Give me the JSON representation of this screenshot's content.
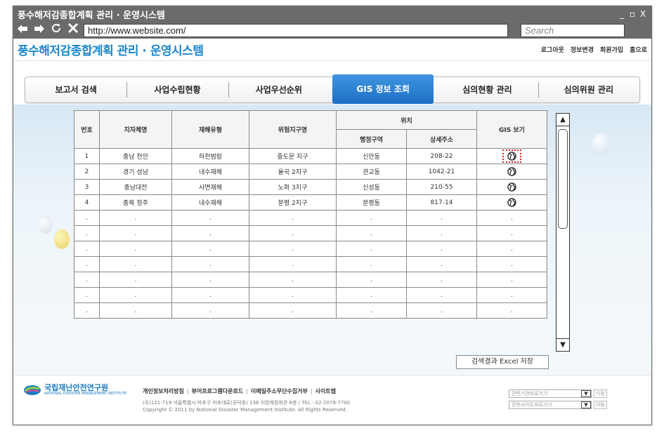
{
  "window": {
    "title": "풍수해저감종합계획 관리 · 운영시스템",
    "controls": [
      "_",
      "▫",
      "X"
    ]
  },
  "browser": {
    "url": "http://www.website.com/",
    "search_placeholder": "Search"
  },
  "header": {
    "brand": "풍수해저감종합계획 관리 · 운영시스템",
    "links": [
      "로그아웃",
      "정보변경",
      "회원가입",
      "홈으로"
    ]
  },
  "tabs": [
    {
      "label": "보고서 검색",
      "active": false
    },
    {
      "label": "사업수립현황",
      "active": false
    },
    {
      "label": "사업우선순위",
      "active": false
    },
    {
      "label": "GIS 정보 조회",
      "active": true
    },
    {
      "label": "심의현황 관리",
      "active": false
    },
    {
      "label": "심의위원 관리",
      "active": false
    }
  ],
  "table": {
    "headers": {
      "no": "번호",
      "city": "지자체명",
      "type": "재해유형",
      "zone": "위험지구명",
      "location": "위치",
      "district": "행정구역",
      "address": "상세주소",
      "gis": "GIS 보기"
    },
    "rows": [
      {
        "no": "1",
        "city": "충남 천안",
        "type": "하천범람",
        "zone": "중도문 지구",
        "district": "신안동",
        "address": "208-22",
        "gis": "globe-icon",
        "highlighted": true
      },
      {
        "no": "2",
        "city": "경기 성남",
        "type": "내수재해",
        "zone": "율곡 2지구",
        "district": "관교동",
        "address": "1042-21",
        "gis": "globe-icon",
        "highlighted": false
      },
      {
        "no": "3",
        "city": "충남대전",
        "type": "사면재해",
        "zone": "노화 3지구",
        "district": "신성동",
        "address": "210-55",
        "gis": "globe-icon",
        "highlighted": false
      },
      {
        "no": "4",
        "city": "충북 청주",
        "type": "내수재해",
        "zone": "분평 2지구",
        "district": "분평동",
        "address": "817-14",
        "gis": "globe-icon",
        "highlighted": false
      },
      {
        "no": ".",
        "city": ".",
        "type": ".",
        "zone": ".",
        "district": ".",
        "address": ".",
        "gis": "."
      },
      {
        "no": ".",
        "city": ".",
        "type": ".",
        "zone": ".",
        "district": ".",
        "address": ".",
        "gis": "."
      },
      {
        "no": ".",
        "city": ".",
        "type": ".",
        "zone": ".",
        "district": ".",
        "address": ".",
        "gis": "."
      },
      {
        "no": ".",
        "city": ".",
        "type": ".",
        "zone": ".",
        "district": ".",
        "address": ".",
        "gis": "."
      },
      {
        "no": ".",
        "city": ".",
        "type": ".",
        "zone": ".",
        "district": ".",
        "address": ".",
        "gis": "."
      },
      {
        "no": ".",
        "city": ".",
        "type": ".",
        "zone": ".",
        "district": ".",
        "address": ".",
        "gis": "."
      },
      {
        "no": ".",
        "city": ".",
        "type": ".",
        "zone": ".",
        "district": ".",
        "address": ".",
        "gis": "."
      }
    ]
  },
  "excel_button": "검색결과 Excel 저장",
  "footer": {
    "org_name": "국립재난안전연구원",
    "org_sub": "NATIONAL DISASTER MANAGEMENT INSTITUTE",
    "links": [
      "개인정보처리방침",
      "뷰어프로그램다운로드",
      "이메일주소무단수집거부",
      "사이트맵"
    ],
    "address_line": "(우)121-719 서울특별시 마포구 마포대로(공덕동) 136 지방재정회관 6층 / TEL : 02-2078-7700",
    "copyright": "Copyright © 2011 by National Disaster Management Institute. All Rights Reserved.",
    "select1": "관련기관바로가기",
    "select2": "관련사이트바로가기",
    "go_label": "이동"
  },
  "colors": {
    "brand_blue": "#1c86c9",
    "tab_active": "#1d6fc4",
    "highlight_red": "#e02020"
  }
}
